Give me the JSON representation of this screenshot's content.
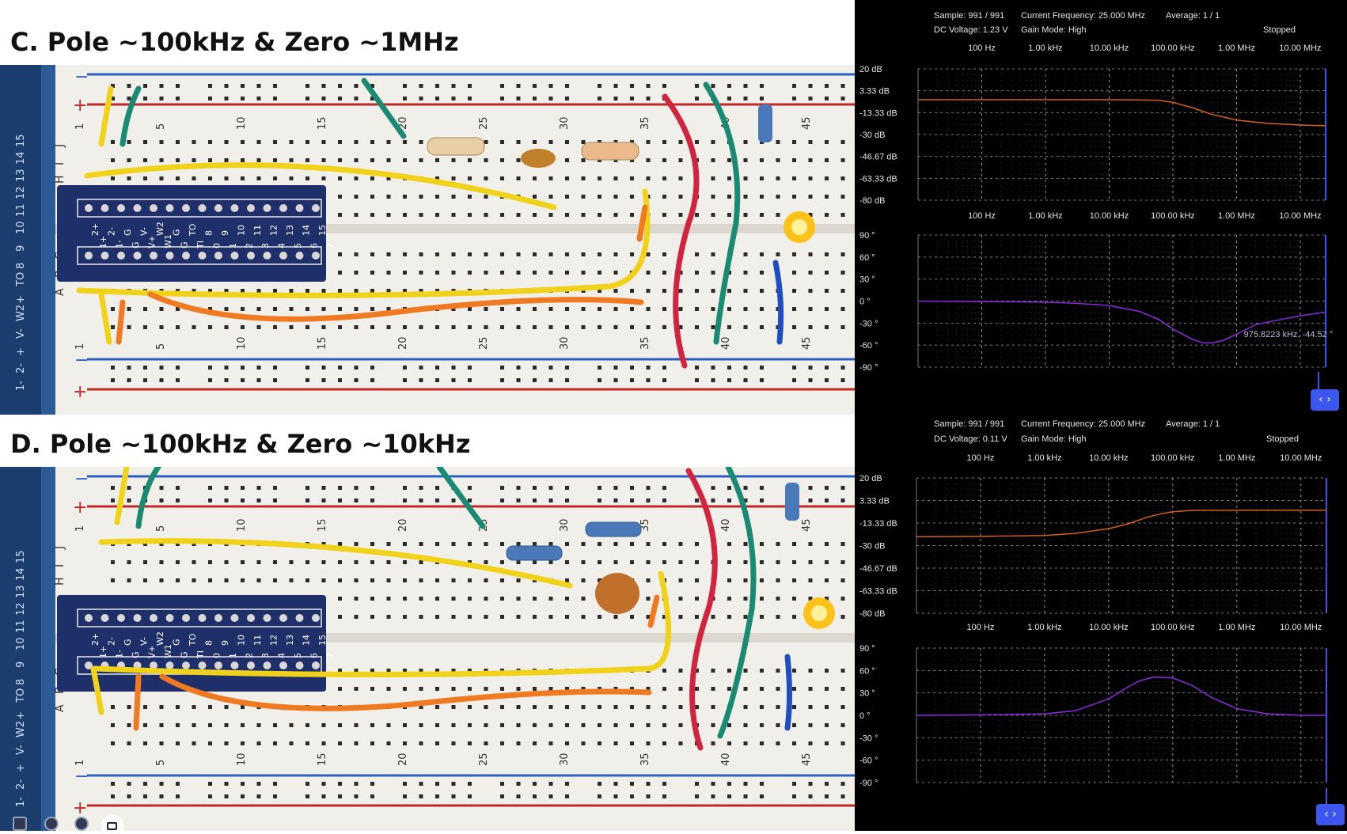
{
  "sections": [
    {
      "title": "C. Pole ~100kHz & Zero ~1MHz",
      "breadboard": {
        "kind": "photo",
        "header_top_labels": [
          "2+",
          "2-",
          "G",
          "V-",
          "W2",
          "G",
          "TO",
          "8",
          "9",
          "10",
          "11",
          "12",
          "13",
          "14",
          "15"
        ],
        "header_bottom_labels": [
          "1+",
          "1-",
          "G",
          "V+",
          "W1",
          "G",
          "TI",
          "0",
          "1",
          "2",
          "3",
          "4",
          "5",
          "6",
          "7"
        ],
        "row_labels": [
          "J",
          "I",
          "H",
          "C",
          "B",
          "A"
        ],
        "column_numbers_top": [
          "1",
          "5",
          "10",
          "15",
          "20",
          "25",
          "30",
          "35",
          "40",
          "45"
        ],
        "column_numbers_bottom": [
          "1",
          "5",
          "10",
          "15",
          "20",
          "25",
          "30",
          "35",
          "40",
          "45"
        ],
        "side_strip_labels": [
          "1-",
          "2-",
          "+",
          "V-",
          "W2",
          "+",
          "TO",
          "8",
          "9",
          "10",
          "11",
          "12",
          "13",
          "14",
          "15"
        ]
      },
      "scope": {
        "status": {
          "sample_label": "Sample:",
          "sample_value": "991 / 991",
          "freq_label": "Current Frequency:",
          "freq_value": "25.000 MHz",
          "avg_label": "Average:",
          "avg_value": "1 / 1",
          "dc_label": "DC Voltage:",
          "dc_value": "1.23 V",
          "gain_label": "Gain Mode:",
          "gain_value": "High",
          "state": "Stopped"
        },
        "nav_button": "‹ ›",
        "trace_colors": {
          "magnitude": "#d9601a",
          "phase": "#8a2be2"
        },
        "marker_readout": "975.8223 kHz, -44.52 °"
      }
    },
    {
      "title": "D. Pole ~100kHz & Zero ~10kHz",
      "breadboard": {
        "kind": "photo",
        "header_top_labels": [
          "2+",
          "2-",
          "G",
          "V-",
          "W2",
          "G",
          "TO",
          "8",
          "9",
          "10",
          "11",
          "12",
          "13",
          "14",
          "15"
        ],
        "header_bottom_labels": [
          "1+",
          "1-",
          "G",
          "V+",
          "W1",
          "G",
          "TI",
          "0",
          "1",
          "2",
          "3",
          "4",
          "5",
          "6",
          "7"
        ],
        "row_labels": [
          "J",
          "I",
          "H",
          "C",
          "B",
          "A"
        ],
        "column_numbers_top": [
          "1",
          "5",
          "10",
          "15",
          "20",
          "25",
          "30",
          "35",
          "40",
          "45"
        ],
        "column_numbers_bottom": [
          "1",
          "5",
          "10",
          "15",
          "20",
          "25",
          "30",
          "35",
          "40",
          "45"
        ],
        "side_strip_labels": [
          "1-",
          "2-",
          "+",
          "V-",
          "W2",
          "+",
          "TO",
          "8",
          "9",
          "10",
          "11",
          "12",
          "13",
          "14",
          "15"
        ]
      },
      "scope": {
        "status": {
          "sample_label": "Sample:",
          "sample_value": "991 / 991",
          "freq_label": "Current Frequency:",
          "freq_value": "25.000 MHz",
          "avg_label": "Average:",
          "avg_value": "1 / 1",
          "dc_label": "DC Voltage:",
          "dc_value": "0.11 V",
          "gain_label": "Gain Mode:",
          "gain_value": "High",
          "state": "Stopped"
        },
        "nav_button": "‹ ›",
        "trace_colors": {
          "magnitude": "#d9601a",
          "phase": "#8a2be2"
        },
        "marker_readout": ""
      }
    }
  ],
  "chart_data": [
    {
      "type": "line",
      "section": "C",
      "plot": "magnitude",
      "xscale": "log",
      "xlim": [
        10,
        25000000
      ],
      "x_tick_labels": [
        "100 Hz",
        "1.00 kHz",
        "10.00 kHz",
        "100.00 kHz",
        "1.00 MHz",
        "10.00 MHz"
      ],
      "x_ticks": [
        100,
        1000,
        10000,
        100000,
        1000000,
        10000000
      ],
      "y_tick_labels": [
        "20 dB",
        "3.33 dB",
        "-13.33 dB",
        "-30 dB",
        "-46.67 dB",
        "-63.33 dB",
        "-80 dB"
      ],
      "ylim": [
        -80,
        20
      ],
      "grid": true,
      "series": [
        {
          "x": [
            10,
            100,
            1000,
            10000,
            30000,
            60000,
            100000,
            200000,
            400000,
            1000000,
            3000000,
            10000000,
            25000000
          ],
          "y": [
            -3.5,
            -3.5,
            -3.5,
            -3.5,
            -3.6,
            -4.0,
            -5.5,
            -9.5,
            -14.5,
            -19.0,
            -21.5,
            -22.8,
            -23.3
          ]
        }
      ]
    },
    {
      "type": "line",
      "section": "C",
      "plot": "phase",
      "xscale": "log",
      "xlim": [
        10,
        25000000
      ],
      "x_tick_labels": [
        "100 Hz",
        "1.00 kHz",
        "10.00 kHz",
        "100.00 kHz",
        "1.00 MHz",
        "10.00 MHz"
      ],
      "x_ticks": [
        100,
        1000,
        10000,
        100000,
        1000000,
        10000000
      ],
      "y_tick_labels": [
        "90 °",
        "60 °",
        "30 °",
        "0 °",
        "-30 °",
        "-60 °",
        "-90 °"
      ],
      "ylim": [
        -90,
        90
      ],
      "grid": true,
      "annotations": [
        {
          "x": 975822.3,
          "y": -44.52,
          "text": "975.8223 kHz, -44.52 °"
        }
      ],
      "series": [
        {
          "x": [
            10,
            100,
            1000,
            3000,
            10000,
            30000,
            60000,
            100000,
            200000,
            300000,
            400000,
            600000,
            1000000,
            2000000,
            5000000,
            10000000,
            25000000
          ],
          "y": [
            0,
            -0.5,
            -1.5,
            -3,
            -6,
            -14,
            -25,
            -38,
            -52,
            -57,
            -57,
            -54,
            -45,
            -32,
            -25,
            -20,
            -15
          ]
        }
      ]
    },
    {
      "type": "line",
      "section": "D",
      "plot": "magnitude",
      "xscale": "log",
      "xlim": [
        10,
        25000000
      ],
      "x_tick_labels": [
        "100 Hz",
        "1.00 kHz",
        "10.00 kHz",
        "100.00 kHz",
        "1.00 MHz",
        "10.00 MHz"
      ],
      "x_ticks": [
        100,
        1000,
        10000,
        100000,
        1000000,
        10000000
      ],
      "y_tick_labels": [
        "20 dB",
        "3.33 dB",
        "-13.33 dB",
        "-30 dB",
        "-46.67 dB",
        "-63.33 dB",
        "-80 dB"
      ],
      "ylim": [
        -80,
        20
      ],
      "grid": true,
      "series": [
        {
          "x": [
            10,
            100,
            1000,
            3000,
            10000,
            20000,
            40000,
            70000,
            100000,
            200000,
            1000000,
            10000000,
            25000000
          ],
          "y": [
            -23.5,
            -23.2,
            -22.5,
            -21.0,
            -17.5,
            -14.0,
            -9.0,
            -6.2,
            -5.0,
            -4.0,
            -3.8,
            -3.8,
            -3.8
          ]
        }
      ]
    },
    {
      "type": "line",
      "section": "D",
      "plot": "phase",
      "xscale": "log",
      "xlim": [
        10,
        25000000
      ],
      "x_tick_labels": [
        "100 Hz",
        "1.00 kHz",
        "10.00 kHz",
        "100.00 kHz",
        "1.00 MHz",
        "10.00 MHz"
      ],
      "x_ticks": [
        100,
        1000,
        10000,
        100000,
        1000000,
        10000000
      ],
      "y_tick_labels": [
        "90 °",
        "60 °",
        "30 °",
        "0 °",
        "-30 °",
        "-60 °",
        "-90 °"
      ],
      "ylim": [
        -90,
        90
      ],
      "grid": true,
      "series": [
        {
          "x": [
            10,
            100,
            1000,
            3000,
            10000,
            20000,
            30000,
            50000,
            100000,
            200000,
            400000,
            1000000,
            3000000,
            10000000,
            25000000
          ],
          "y": [
            0,
            0.5,
            2,
            6,
            22,
            38,
            46,
            51,
            50,
            40,
            24,
            9,
            2,
            0,
            0
          ]
        }
      ]
    }
  ]
}
